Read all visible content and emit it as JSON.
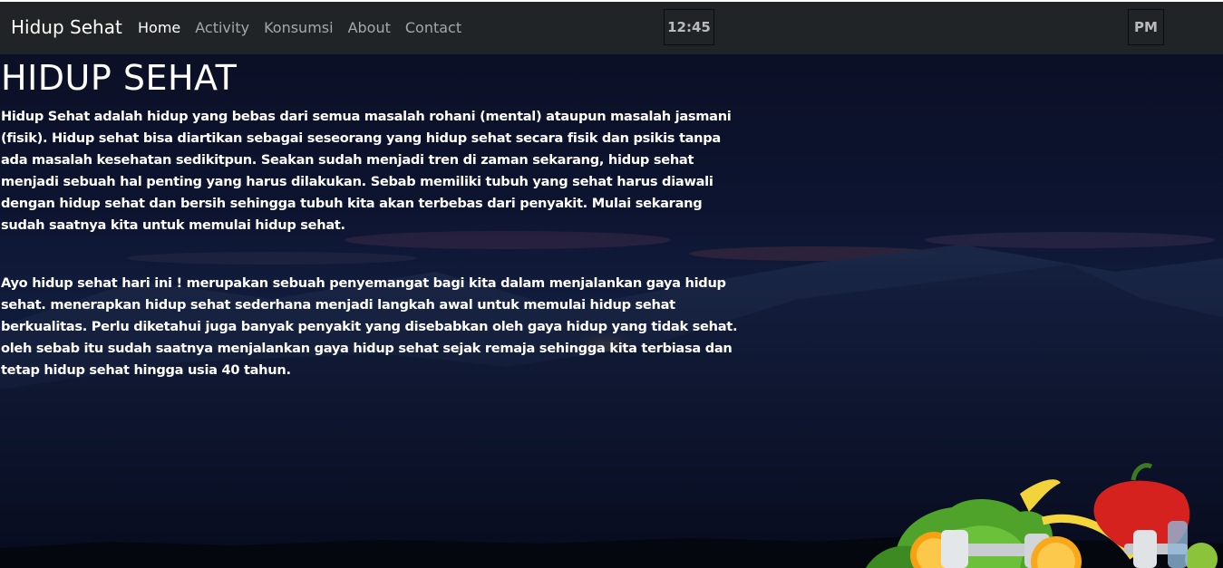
{
  "navbar": {
    "brand": "Hidup Sehat",
    "links": [
      {
        "label": "Home",
        "active": true
      },
      {
        "label": "Activity",
        "active": false
      },
      {
        "label": "Konsumsi",
        "active": false
      },
      {
        "label": "About",
        "active": false
      },
      {
        "label": "Contact",
        "active": false
      }
    ],
    "clock_time": "12:45",
    "clock_ampm": "PM"
  },
  "main": {
    "title": "HIDUP SEHAT",
    "paragraphs": [
      "Hidup Sehat adalah hidup yang bebas dari semua masalah rohani (mental) ataupun masalah jasmani (fisik). Hidup sehat bisa diartikan sebagai seseorang yang hidup sehat secara fisik dan psikis tanpa ada masalah kesehatan sedikitpun. Seakan sudah menjadi tren di zaman sekarang, hidup sehat menjadi sebuah hal penting yang harus dilakukan. Sebab memiliki tubuh yang sehat harus diawali dengan hidup sehat dan bersih sehingga tubuh kita akan terbebas dari penyakit. Mulai sekarang sudah saatnya kita untuk memulai hidup sehat.",
      "Ayo hidup sehat hari ini ! merupakan sebuah penyemangat bagi kita dalam menjalankan gaya hidup sehat. menerapkan hidup sehat sederhana menjadi langkah awal untuk memulai hidup sehat berkualitas. Perlu diketahui juga banyak penyakit yang disebabkan oleh gaya hidup yang tidak sehat. oleh sebab itu sudah saatnya menjalankan gaya hidup sehat sejak remaja sehingga kita terbiasa dan tetap hidup sehat hingga usia 40 tahun."
    ]
  },
  "colors": {
    "navbar_bg": "#212427",
    "nav_active": "#ffffff",
    "nav_inactive": "#a5a7aa",
    "hero_bg": "#0b1026",
    "text": "#ffffff"
  },
  "icons": {
    "food_image": "healthy-food-illustration-icon",
    "background": "sunset-mountain-background"
  }
}
